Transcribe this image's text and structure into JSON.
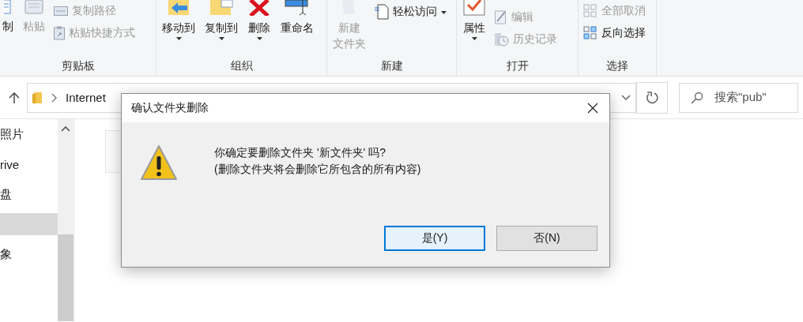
{
  "ribbon": {
    "groups": [
      {
        "label": "剪贴板",
        "columns": [
          {
            "kind": "large",
            "label": "制",
            "disabled": false,
            "dropdown": false
          },
          {
            "kind": "large",
            "label": "粘贴",
            "disabled": true,
            "dropdown": false
          },
          {
            "kind": "stack",
            "items": [
              {
                "label": "复制路径",
                "disabled": true
              },
              {
                "label": "粘贴快捷方式",
                "disabled": true
              }
            ]
          }
        ]
      },
      {
        "label": "组织",
        "columns": [
          {
            "kind": "large",
            "label": "移动到",
            "disabled": false,
            "dropdown": true
          },
          {
            "kind": "large",
            "label": "复制到",
            "disabled": false,
            "dropdown": true
          },
          {
            "kind": "large",
            "label": "删除",
            "disabled": false,
            "dropdown": true
          },
          {
            "kind": "large",
            "label": "重命名",
            "disabled": false,
            "dropdown": false
          }
        ]
      },
      {
        "label": "新建",
        "columns": [
          {
            "kind": "large",
            "lines": [
              "新建",
              "文件夹"
            ],
            "disabled": true,
            "dropdown": false
          },
          {
            "kind": "stack",
            "items": [
              {
                "label": "轻松访问",
                "disabled": false,
                "dropdown": true
              }
            ]
          }
        ]
      },
      {
        "label": "打开",
        "columns": [
          {
            "kind": "large",
            "label": "属性",
            "disabled": false,
            "dropdown": true
          },
          {
            "kind": "stack",
            "items": [
              {
                "label": "编辑",
                "disabled": true
              },
              {
                "label": "历史记录",
                "disabled": true
              }
            ]
          }
        ]
      },
      {
        "label": "选择",
        "columns": [
          {
            "kind": "stack",
            "items": [
              {
                "label": "全部取消",
                "disabled": true
              },
              {
                "label": "反向选择",
                "disabled": false
              }
            ]
          }
        ]
      }
    ]
  },
  "address_bar": {
    "path": [
      "Internet"
    ]
  },
  "search": {
    "placeholder": "搜索\"pub\""
  },
  "navigation": {
    "items": [
      {
        "label": "照片",
        "selected": false
      },
      {
        "label": "rive",
        "selected": false
      },
      {
        "label": "盘",
        "selected": false
      },
      {
        "selected": true
      },
      {
        "label": "象",
        "selected": false
      }
    ]
  },
  "dialog": {
    "title": "确认文件夹删除",
    "message": "你确定要删除文件夹 '新文件夹' 吗?",
    "detail": "(删除文件夹将会删除它所包含的所有内容)",
    "buttons": [
      {
        "label": "是(Y)",
        "selected": true
      },
      {
        "label": "否(N)",
        "selected": false
      }
    ]
  }
}
